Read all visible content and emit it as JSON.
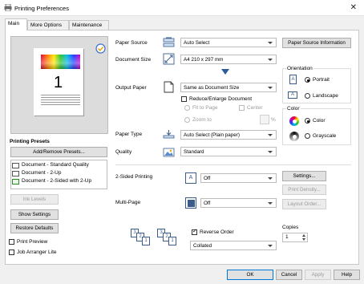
{
  "window": {
    "title": "Printing Preferences"
  },
  "tabs": [
    "Main",
    "More Options",
    "Maintenance"
  ],
  "presets": {
    "heading": "Printing Presets",
    "add_remove": "Add/Remove Presets...",
    "items": [
      "Document - Standard Quality",
      "Document - 2-Up",
      "Document - 2-Sided with 2-Up"
    ]
  },
  "left_buttons": {
    "ink": "Ink Levels",
    "show": "Show Settings",
    "restore": "Restore Defaults"
  },
  "left_checks": {
    "preview": "Print Preview",
    "arranger": "Job Arranger Lite"
  },
  "preview": {
    "page_number": "1"
  },
  "paper_source": {
    "label": "Paper Source",
    "value": "Auto Select",
    "button": "Paper Source Information"
  },
  "document_size": {
    "label": "Document Size",
    "value": "A4 210 x 297 mm"
  },
  "output_paper": {
    "label": "Output Paper",
    "value": "Same as Document Size"
  },
  "reduce": {
    "label": "Reduce/Enlarge Document",
    "fit": "Fit to Page",
    "center": "Center",
    "zoom": "Zoom to",
    "pct": "%"
  },
  "paper_type": {
    "label": "Paper Type",
    "value": "Auto Select (Plain paper)"
  },
  "quality": {
    "label": "Quality",
    "value": "Standard"
  },
  "orientation": {
    "label": "Orientation",
    "portrait": "Portrait",
    "landscape": "Landscape"
  },
  "color": {
    "label": "Color",
    "color": "Color",
    "gray": "Grayscale"
  },
  "two_sided": {
    "label": "2-Sided Printing",
    "value": "Off",
    "settings": "Settings...",
    "density": "Print Density..."
  },
  "multi_page": {
    "label": "Multi-Page",
    "value": "Off",
    "layout": "Layout Order..."
  },
  "order": {
    "reverse": "Reverse Order",
    "collated": "Collated",
    "copies_label": "Copies",
    "copies": "1",
    "stack_nums": [
      "3",
      "2",
      "1",
      "3",
      "2",
      "1"
    ]
  },
  "footer": {
    "ok": "OK",
    "cancel": "Cancel",
    "apply": "Apply",
    "help": "Help"
  }
}
